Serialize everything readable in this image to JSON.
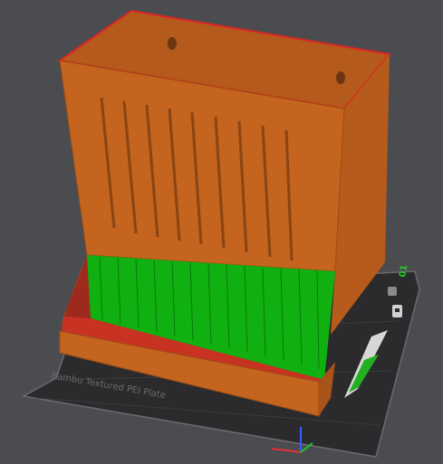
{
  "viewport": {
    "plate_label": "Bambu Textured PEI Plate",
    "plate_number": "01",
    "colors": {
      "background": "#4b4c50",
      "plate": "#2b2b2d",
      "plate_border": "#6b6b6e",
      "model_front": "#c4641e",
      "model_side": "#a8531a",
      "model_top_edge": "#e02424",
      "infill_green": "#10b010",
      "axis_x": "#e53030",
      "axis_y": "#22c822",
      "axis_z": "#3060ff"
    },
    "icons": [
      "lock-icon",
      "plate-settings-icon",
      "wall-hanger-hole-icon"
    ]
  }
}
